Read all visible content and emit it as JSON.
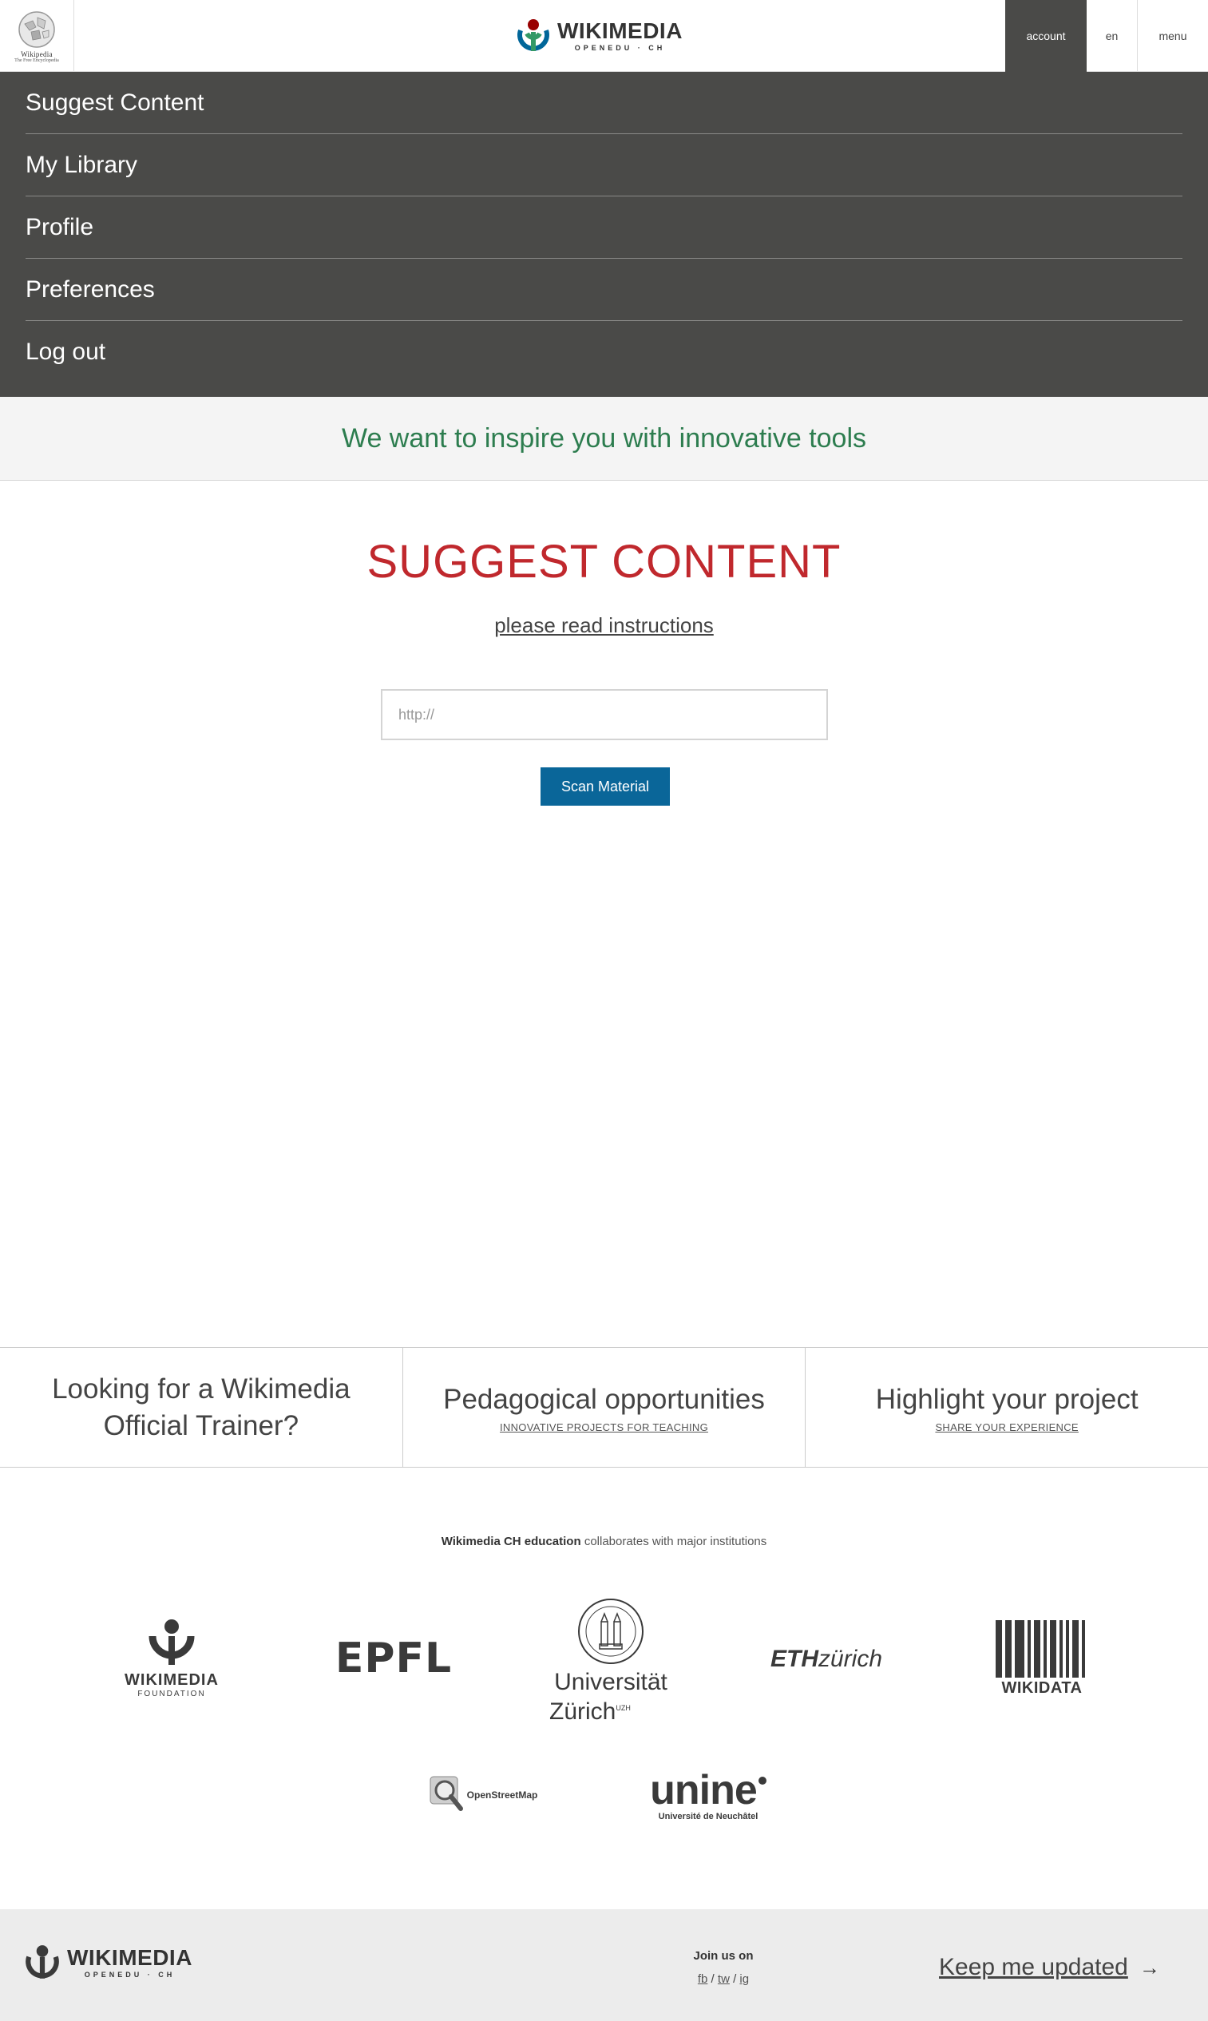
{
  "header": {
    "wikipedia_logo": {
      "name": "Wikipedia",
      "tagline": "The Free Encyclopedia",
      "icon": "wikipedia-globe-icon"
    },
    "brand": {
      "name": "WIKIMEDIA",
      "sub": "OPENEDU · CH",
      "icon": "wikimedia-logo-icon"
    },
    "account_label": "account",
    "language_label": "en",
    "menu_label": "menu"
  },
  "account_menu": {
    "items": [
      "Suggest Content",
      "My Library",
      "Profile",
      "Preferences",
      "Log out"
    ]
  },
  "tagline": "We want to inspire you with innovative tools",
  "main": {
    "title": "SUGGEST CONTENT",
    "instructions_link": "please read instructions",
    "url_placeholder": "http://",
    "url_value": "",
    "scan_button": "Scan Material"
  },
  "promo": {
    "trainer_title": "Looking for a Wikimedia Official Trainer?",
    "pedagogical_title": "Pedagogical opportunities",
    "pedagogical_sub": "INNOVATIVE PROJECTS FOR TEACHING",
    "highlight_title": "Highlight your project",
    "highlight_sub": "SHARE YOUR EXPERIENCE"
  },
  "collaborates": {
    "bold": "Wikimedia CH education",
    "rest": "collaborates with major institutions"
  },
  "partners": {
    "wikimedia_foundation": {
      "name": "WIKIMEDIA",
      "sub": "FOUNDATION"
    },
    "epfl": {
      "name": "EPFL"
    },
    "uzh": {
      "line1": "Universität",
      "line2": "Zürich",
      "sup": "UZH"
    },
    "eth": {
      "bold": "ETH",
      "rest": "zürich"
    },
    "wikidata": {
      "name": "WIKIDATA"
    },
    "osm": {
      "name": "OpenStreetMap"
    },
    "unine": {
      "name": "unine",
      "sub": "Université de Neuchâtel"
    }
  },
  "footer": {
    "brand": {
      "name": "WIKIMEDIA",
      "sub": "OPENEDU · CH"
    },
    "join_label": "Join us on",
    "social": [
      "fb",
      "tw",
      "ig"
    ],
    "keep_updated": "Keep me updated",
    "arrow_icon": "arrow-right-icon"
  },
  "colors": {
    "menu_bg": "#4a4a48",
    "tagline_green": "#2d7d4f",
    "title_red": "#c0282d",
    "button_blue": "#0a6699",
    "footer_bg": "#ececec"
  }
}
